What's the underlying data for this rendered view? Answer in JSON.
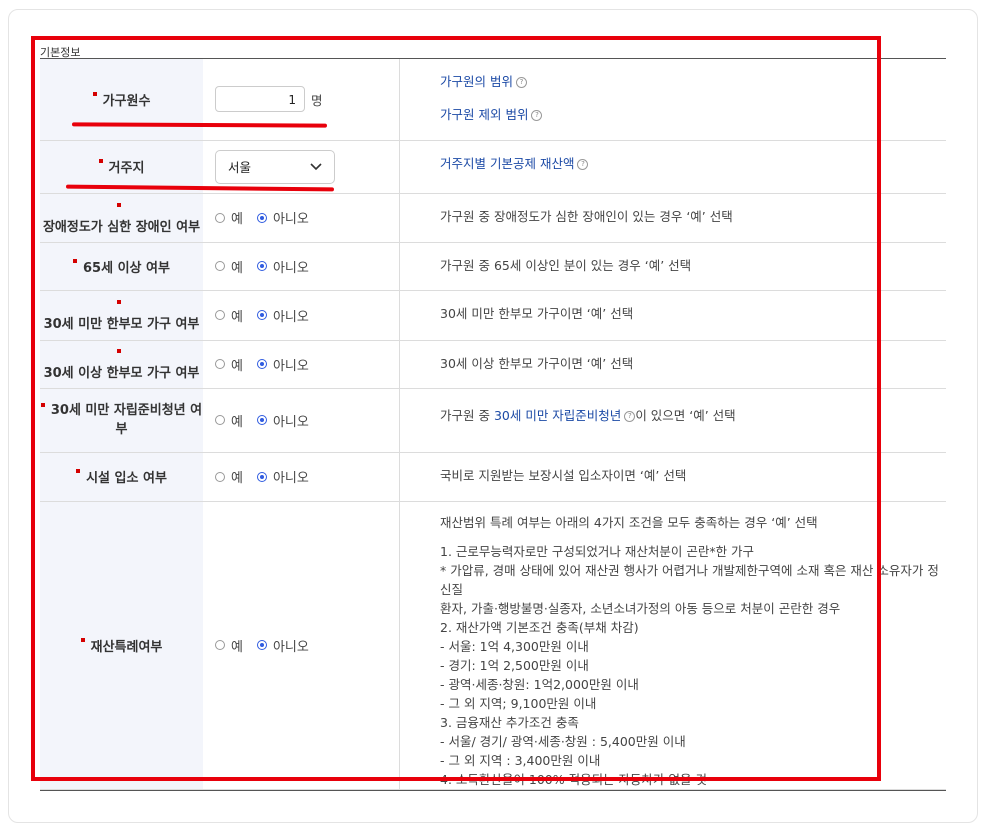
{
  "section_title": "기본정보",
  "rows": {
    "household": {
      "label": "가구원수",
      "value": "1",
      "unit": "명",
      "links": [
        "가구원의 범위",
        "가구원 제외 범위"
      ]
    },
    "residence": {
      "label": "거주지",
      "value": "서울",
      "link": "거주지별 기본공제 재산액"
    },
    "disabled": {
      "label": "장애정도가 심한 장애인 여부",
      "yes": "예",
      "no": "아니오",
      "selected": "아니오",
      "desc": "가구원 중 장애정도가 심한 장애인이 있는 경우 ‘예’ 선택"
    },
    "over65": {
      "label": "65세 이상 여부",
      "yes": "예",
      "no": "아니오",
      "selected": "아니오",
      "desc": "가구원 중 65세 이상인 분이 있는 경우 ‘예’ 선택"
    },
    "single_under30": {
      "label": "30세 미만 한부모 가구 여부",
      "yes": "예",
      "no": "아니오",
      "selected": "아니오",
      "desc": "30세 미만 한부모 가구이면 ‘예’ 선택"
    },
    "single_over30": {
      "label": "30세 이상 한부모 가구 여부",
      "yes": "예",
      "no": "아니오",
      "selected": "아니오",
      "desc": "30세 이상 한부모 가구이면 ‘예’ 선택"
    },
    "youth": {
      "label_line1": "30세 미만 자립준비청년 여",
      "label_line2": "부",
      "yes": "예",
      "no": "아니오",
      "selected": "아니오",
      "desc_prefix": "가구원 중 ",
      "desc_link": "30세 미만 자립준비청년",
      "desc_suffix": "이 있으면 ‘예’ 선택"
    },
    "facility": {
      "label": "시설 입소 여부",
      "yes": "예",
      "no": "아니오",
      "selected": "아니오",
      "desc": "국비로 지원받는 보장시설 입소자이면 ‘예’ 선택"
    },
    "property": {
      "label": "재산특례여부",
      "yes": "예",
      "no": "아니오",
      "selected": "아니오",
      "desc_intro": "재산범위 특례 여부는 아래의 4가지 조건을 모두 충족하는 경우 ‘예’ 선택",
      "desc_lines": [
        "1. 근로무능력자로만 구성되었거나 재산처분이 곤란*한 가구",
        "* 가압류, 경매 상태에 있어 재산권 행사가 어렵거나 개발제한구역에 소재 혹은 재산 소유자가 정신질",
        "환자, 가출·행방불명·실종자, 소년소녀가정의 아동 등으로 처분이 곤란한 경우",
        "2. 재산가액 기본조건 충족(부채 차감)",
        "- 서울: 1억 4,300만원 이내",
        "- 경기: 1억 2,500만원 이내",
        "- 광역·세종·창원: 1억2,000만원 이내",
        "- 그 외 지역; 9,100만원 이내",
        "3. 금융재산 추가조건 충족",
        "- 서울/ 경기/ 광역·세종·창원 : 5,400만원 이내",
        "- 그 외 지역 : 3,400만원 이내",
        "4. 소득환산율이 100% 적용되는 자동차가 없을 것"
      ]
    }
  },
  "info_icon": "?",
  "chevron": "⌄",
  "colors": {
    "highlight": "#e8000b",
    "link": "#1c4aa6",
    "radio_on": "#2f5be0",
    "label_bg": "#f3f5fb"
  }
}
